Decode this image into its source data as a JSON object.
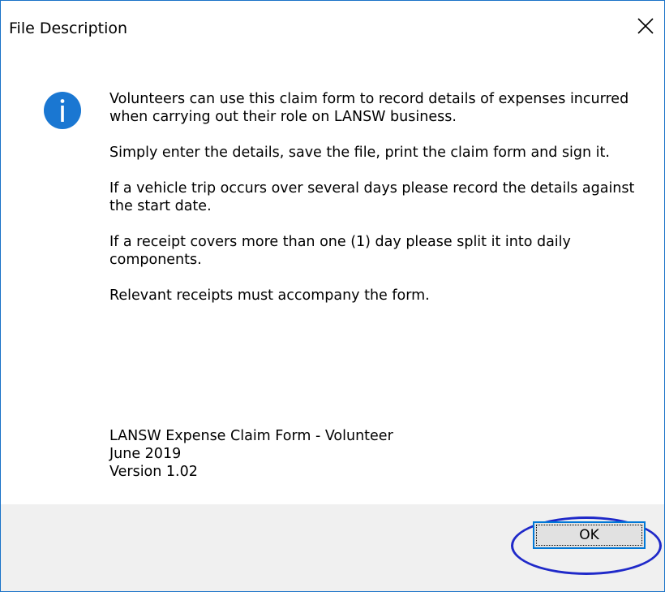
{
  "dialog": {
    "title": "File Description",
    "close_icon": "close-icon",
    "info_icon": "information-icon",
    "accent_color": "#0078d7",
    "messages": [
      "Volunteers can use this claim form to record details of expenses incurred when carrying out their role on LANSW business.",
      "Simply enter the details, save the file, print the claim form and sign it.",
      "If a vehicle trip occurs over several days please record the details against the start date.",
      "If a receipt covers more than one (1) day please split it into daily components.",
      "Relevant receipts must accompany the form."
    ],
    "form_name": "LANSW Expense Claim Form - Volunteer",
    "date": "June 2019",
    "version": "Version 1.02",
    "ok_label": "OK",
    "highlight_color": "#1f29c9"
  }
}
